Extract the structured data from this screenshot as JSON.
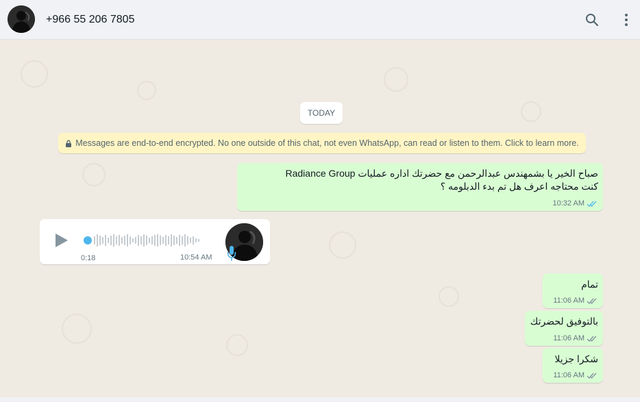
{
  "header": {
    "contact_name": "+966 55 206 7805",
    "icons": [
      "avatar",
      "search-icon",
      "menu-icon"
    ]
  },
  "chat": {
    "date_divider": "TODAY",
    "encryption_notice": "Messages are end-to-end encrypted. No one outside of this chat, not even WhatsApp, can read or listen to them. Click to learn more.",
    "messages": [
      {
        "direction": "outgoing",
        "lines": [
          "صباح الخير يا بشمهندس عبدالرحمن مع حضرتك اداره عمليات Radiance Group",
          "كنت محتاجه اعرف هل تم بدء الدبلومه ؟"
        ],
        "time": "10:32 AM",
        "status": "read"
      },
      {
        "direction": "incoming",
        "type": "voice",
        "duration": "0:18",
        "time": "10:54 AM"
      },
      {
        "direction": "outgoing",
        "text": "تمام",
        "time": "11:06 AM",
        "status": "delivered"
      },
      {
        "direction": "outgoing",
        "text": "بالتوفيق لحضرتك",
        "time": "11:06 AM",
        "status": "delivered"
      },
      {
        "direction": "outgoing",
        "text": "شكرا جزيلا",
        "time": "11:06 AM",
        "status": "delivered"
      }
    ]
  },
  "colors": {
    "chat_bg": "#efeae2",
    "outgoing_bubble": "#d9fdd3",
    "incoming_bubble": "#ffffff",
    "read_ticks": "#53bdeb",
    "delivered_ticks": "#8696a0",
    "header_bg": "#f0f2f5",
    "notice_bg": "#fff5c4"
  }
}
